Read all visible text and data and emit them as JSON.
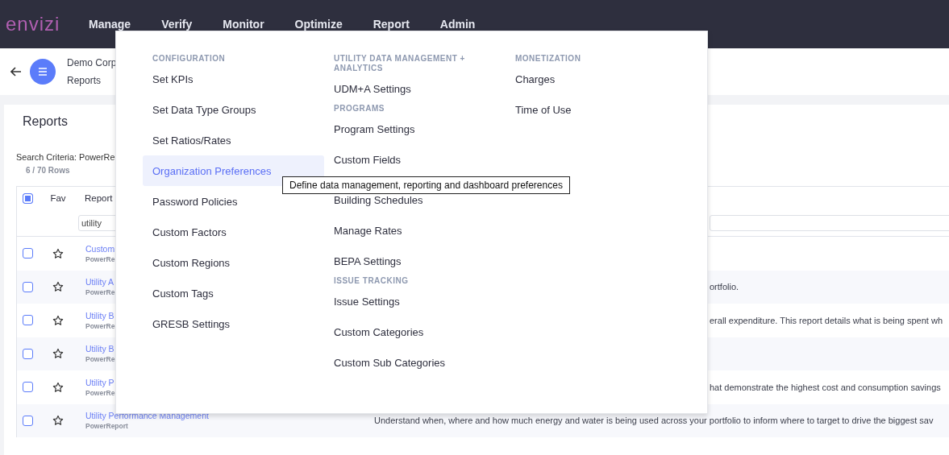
{
  "logo": "envizi",
  "nav": [
    {
      "label": "Manage"
    },
    {
      "label": "Verify"
    },
    {
      "label": "Monitor"
    },
    {
      "label": "Optimize"
    },
    {
      "label": "Report"
    },
    {
      "label": "Admin"
    }
  ],
  "header": {
    "org": "Demo Corp",
    "page": "Reports"
  },
  "reports": {
    "title": "Reports",
    "search_criteria": "Search Criteria: PowerRe",
    "row_count": "6 / 70 Rows",
    "columns": {
      "all_checked": true,
      "fav": "Fav",
      "report": "Report"
    },
    "filter": {
      "value": "utility"
    },
    "rows": [
      {
        "checked": false,
        "favorite": false,
        "name": "Custom",
        "source": "PowerRe",
        "description": ""
      },
      {
        "checked": false,
        "favorite": false,
        "name": "Utility A",
        "source": "PowerRe",
        "description": "ortfolio.",
        "description_after_menu": true
      },
      {
        "checked": false,
        "favorite": false,
        "name": "Utility B",
        "source": "PowerRe",
        "description": "erall expenditure. This report details what is being spent wh",
        "description_after_menu": true
      },
      {
        "checked": false,
        "favorite": false,
        "name": "Utility B",
        "source": "PowerRe",
        "description": ""
      },
      {
        "checked": false,
        "favorite": false,
        "name": "Utility P",
        "source": "PowerRe",
        "description": "hat demonstrate the highest cost and consumption savings",
        "description_after_menu": true
      },
      {
        "checked": false,
        "favorite": false,
        "name": "Utility Performance Management",
        "source": "PowerReport",
        "description": "Understand when, where and how much energy and water is being used across your portfolio to inform where to target to drive the biggest sav",
        "description_after_menu": false
      }
    ]
  },
  "menu": {
    "columns": [
      [
        {
          "heading": "CONFIGURATION",
          "items": [
            {
              "label": "Set KPIs",
              "selected": false
            },
            {
              "label": "Set Data Type Groups",
              "selected": false
            },
            {
              "label": "Set Ratios/Rates",
              "selected": false
            },
            {
              "label": "Organization Preferences",
              "selected": true
            },
            {
              "label": "Password Policies",
              "selected": false
            },
            {
              "label": "Custom Factors",
              "selected": false
            },
            {
              "label": "Custom Regions",
              "selected": false
            },
            {
              "label": "Custom Tags",
              "selected": false
            },
            {
              "label": "GRESB Settings",
              "selected": false
            }
          ]
        }
      ],
      [
        {
          "heading": "UTILITY DATA MANAGEMENT + ANALYTICS",
          "items": [
            {
              "label": "UDM+A Settings",
              "selected": false
            }
          ]
        },
        {
          "heading": "PROGRAMS",
          "items": [
            {
              "label": "Program Settings",
              "selected": false
            },
            {
              "label": "Custom Fields",
              "selected": false
            }
          ]
        },
        {
          "items": [
            {
              "label": "Building Schedules",
              "selected": false
            },
            {
              "label": "Manage Rates",
              "selected": false
            },
            {
              "label": "BEPA Settings",
              "selected": false
            }
          ]
        },
        {
          "heading": "ISSUE TRACKING",
          "items": [
            {
              "label": "Issue Settings",
              "selected": false
            },
            {
              "label": "Custom Categories",
              "selected": false
            },
            {
              "label": "Custom Sub Categories",
              "selected": false
            }
          ]
        }
      ],
      [
        {
          "heading": "MONETIZATION",
          "items": [
            {
              "label": "Charges",
              "selected": false
            },
            {
              "label": "Time of Use",
              "selected": false
            }
          ]
        }
      ]
    ],
    "tooltip": "Define data management, reporting and dashboard preferences"
  }
}
